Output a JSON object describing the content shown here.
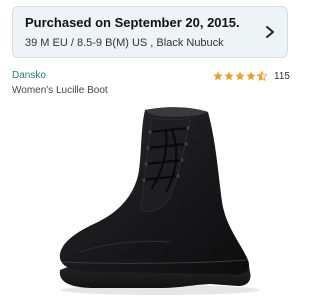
{
  "order": {
    "purchased_text": "Purchased on September 20, 2015.",
    "variant_text": "39 M EU / 8.5-9 B(M) US , Black Nubuck"
  },
  "product": {
    "brand": "Dansko",
    "name": "Women's Lucille Boot",
    "image_icon": "black-nubuck-lace-up-wedge-boot"
  },
  "rating": {
    "stars": 4.5,
    "max_stars": 5,
    "review_count": "115",
    "star_color": "#f29d1e"
  },
  "colors": {
    "card_background": "#eef3f6",
    "brand_link": "#1f7a8c"
  }
}
